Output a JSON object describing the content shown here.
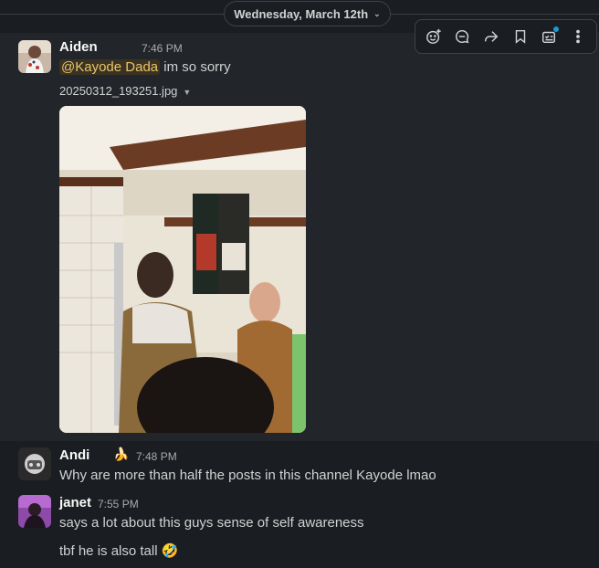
{
  "date_divider": {
    "label": "Wednesday, March 12th"
  },
  "toolbar": {
    "icons": [
      "add-reaction-icon",
      "reply-thread-icon",
      "forward-icon",
      "bookmark-icon",
      "add-to-list-icon",
      "more-actions-icon"
    ]
  },
  "messages": [
    {
      "author": "Aiden",
      "time": "7:46 PM",
      "mention": "@Kayode Dada",
      "text": " im so sorry",
      "attachment": {
        "filename": "20250312_193251.jpg"
      }
    },
    {
      "author": "Andi",
      "status_emoji": "🍌",
      "time": "7:48 PM",
      "text": "Why are more than half the posts in this channel Kayode lmao"
    },
    {
      "author": "janet",
      "time": "7:55 PM",
      "text": "says a lot about this guys sense of self awareness",
      "followup": "tbf he is also tall",
      "followup_emoji": "🤣"
    }
  ],
  "colors": {
    "background": "#1a1d21",
    "hover_background": "#222529",
    "mention_text": "#e8c46b",
    "notification_dot": "#1d9bd1"
  }
}
